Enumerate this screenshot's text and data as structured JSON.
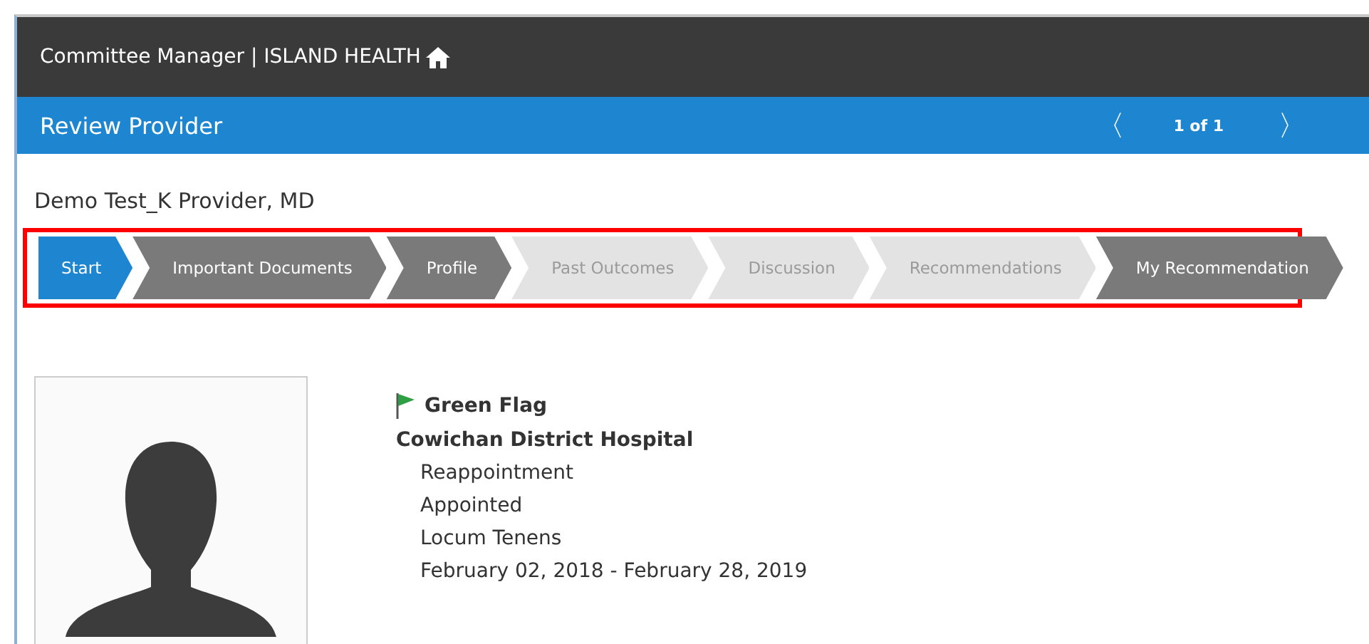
{
  "header": {
    "title": "Committee Manager | ISLAND HEALTH"
  },
  "subheader": {
    "title": "Review Provider",
    "pager": {
      "previous": "〈",
      "position": "1 of 1",
      "next": "〉"
    }
  },
  "provider": {
    "name": "Demo Test_K Provider, MD"
  },
  "steps": [
    {
      "label": "Start",
      "selected": true,
      "disabled": false
    },
    {
      "label": "Important Documents",
      "selected": false,
      "disabled": false
    },
    {
      "label": "Profile",
      "selected": false,
      "disabled": false
    },
    {
      "label": "Past Outcomes",
      "selected": false,
      "disabled": true
    },
    {
      "label": "Discussion",
      "selected": false,
      "disabled": true
    },
    {
      "label": "Recommendations",
      "selected": false,
      "disabled": true
    },
    {
      "label": "My Recommendation",
      "selected": false,
      "disabled": false
    }
  ],
  "details": {
    "flag": {
      "label": "Green Flag",
      "color": "#2ea043"
    },
    "facility": "Cowichan District Hospital",
    "lines": [
      "Reappointment",
      "Appointed",
      "Locum Tenens",
      "February 02, 2018 - February 28, 2019"
    ]
  }
}
